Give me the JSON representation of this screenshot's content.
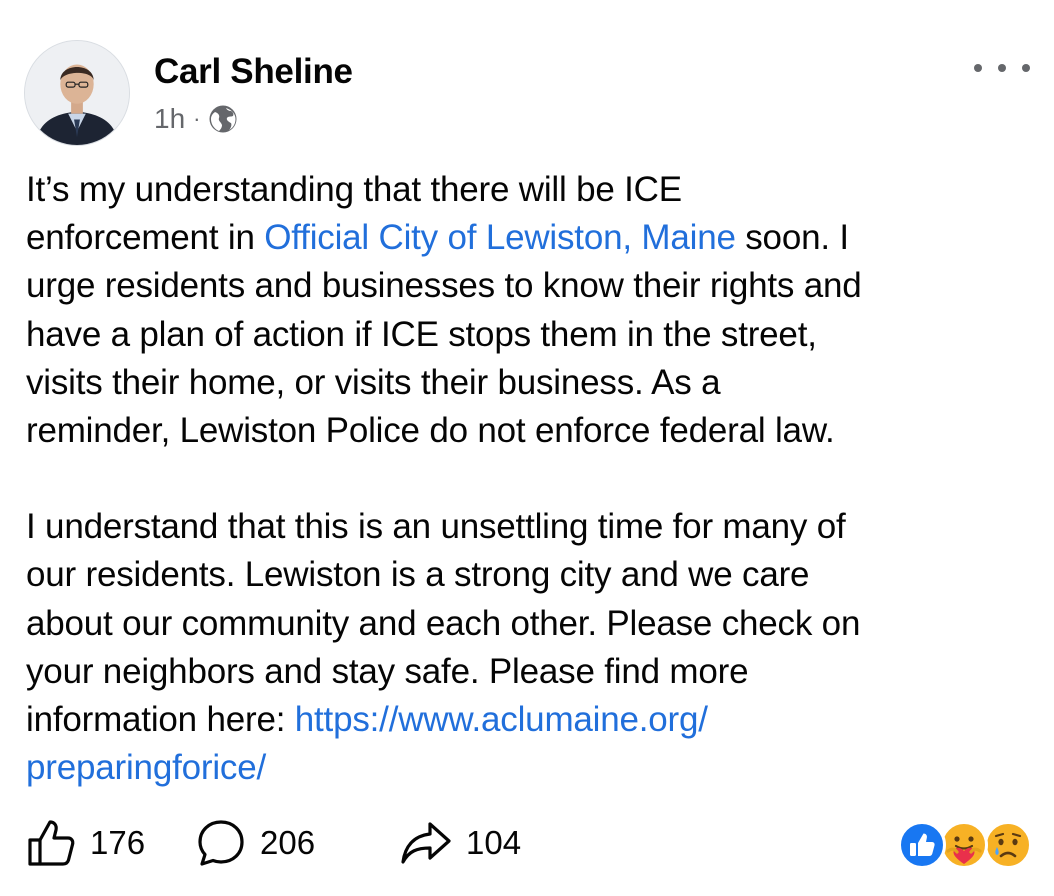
{
  "post": {
    "author": "Carl Sheline",
    "time": "1h",
    "separator": "·",
    "audience_icon": "globe-icon",
    "paragraph1": {
      "before_link": "It’s my understanding that there will be ICE",
      "line2_before": "enforcement in ",
      "link_text": "Official City of Lewiston, Maine",
      "line2_after": " soon. I",
      "line3": "urge residents and businesses to know their rights and",
      "line4": "have a plan of action if ICE stops them in the street,",
      "line5": "visits their home, or visits their business. As a",
      "line6": "reminder, Lewiston Police do not enforce federal law."
    },
    "paragraph2": {
      "line1": "I understand that this is an unsettling time for many of",
      "line2": "our residents. Lewiston is a strong city and we care",
      "line3": "about our community and each other. Please check on",
      "line4": "your neighbors and stay safe. Please find more",
      "line5_before": "information here: ",
      "url_part1": "https://www.aclumaine.org/",
      "url_part2": "preparingforice/"
    }
  },
  "actions": {
    "likes": "176",
    "comments": "206",
    "shares": "104"
  },
  "reactions": [
    "like",
    "care",
    "sad"
  ],
  "colors": {
    "link": "#216fdb",
    "secondary_text": "#65676b",
    "like_blue": "#1877f2"
  }
}
